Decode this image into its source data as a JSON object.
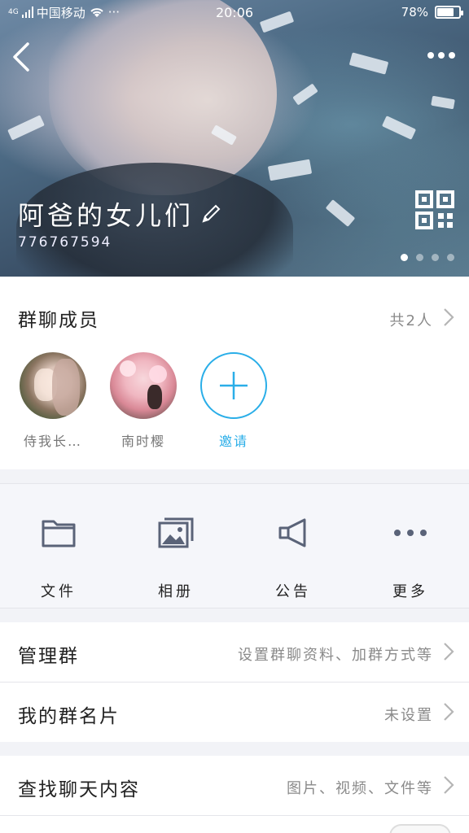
{
  "status": {
    "signal": "4G",
    "carrier": "中国移动",
    "more": "···",
    "time": "20:06",
    "battery_text": "78%",
    "battery_level": 0.78
  },
  "header": {
    "group_name": "阿爸的女儿们",
    "group_id": "776767594",
    "banner_page_count": 4,
    "banner_active_index": 0
  },
  "members": {
    "title": "群聊成员",
    "count_text": "共2人",
    "items": [
      {
        "name": "侍我长…"
      },
      {
        "name": "南时樱"
      }
    ],
    "invite_label": "邀请"
  },
  "actions": [
    {
      "label": "文件",
      "icon": "folder-icon"
    },
    {
      "label": "相册",
      "icon": "album-icon"
    },
    {
      "label": "公告",
      "icon": "megaphone-icon"
    },
    {
      "label": "更多",
      "icon": "more-icon"
    }
  ],
  "rows": {
    "manage": {
      "title": "管理群",
      "hint": "设置群聊资料、加群方式等"
    },
    "card": {
      "title": "我的群名片",
      "hint": "未设置"
    },
    "search": {
      "title": "查找聊天内容",
      "hint": "图片、视频、文件等"
    }
  },
  "colors": {
    "accent": "#2aaee8",
    "icon_gray": "#5a6378"
  }
}
